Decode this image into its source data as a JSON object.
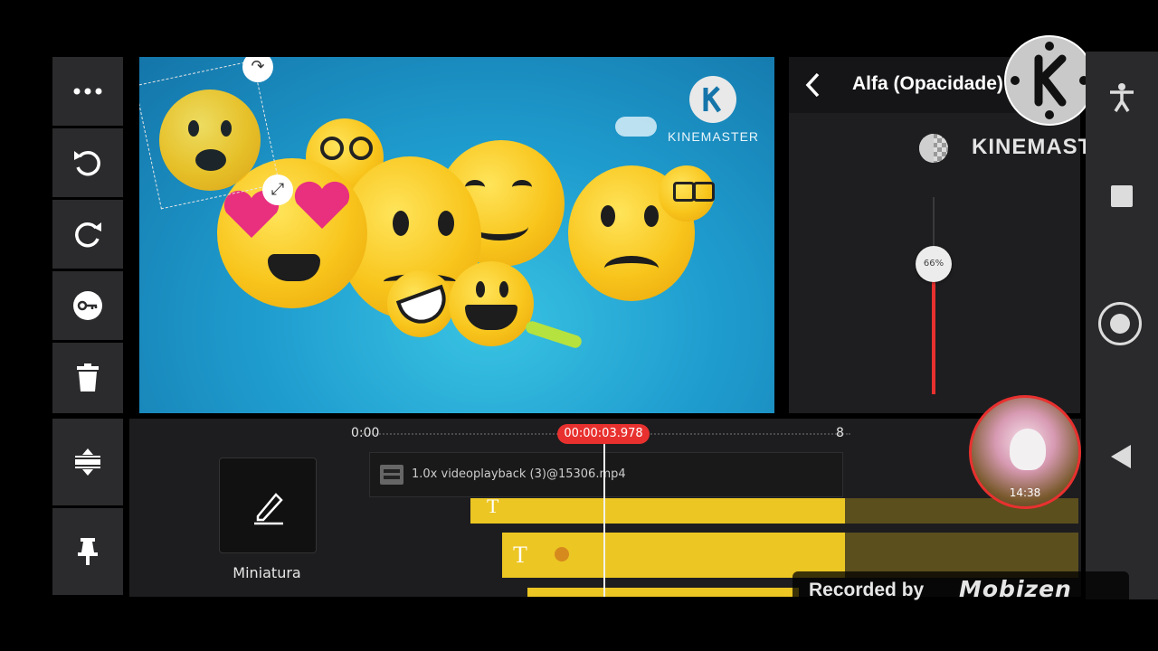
{
  "toolbar": {
    "items": [
      {
        "name": "more-icon"
      },
      {
        "name": "undo-icon"
      },
      {
        "name": "redo-icon"
      },
      {
        "name": "keyframe-key-icon"
      },
      {
        "name": "trash-icon"
      },
      {
        "name": "adjust-tracks-icon"
      },
      {
        "name": "pin-icon"
      }
    ]
  },
  "preview": {
    "watermark_text": "KINEMASTER"
  },
  "panel": {
    "title": "Alfa (Opacidade)",
    "brand_text": "KINEMASTER",
    "slider_label": "66%",
    "slider_value_percent": 66
  },
  "timeline": {
    "start_time": "0:00",
    "playhead_time": "00:00:03.978",
    "end_time": "8",
    "clip_label": "1.0x videoplayback (3)@15306.mp4",
    "thumbnail_label": "Miniatura",
    "text_layer_glyph": "T"
  },
  "overlay": {
    "recorded_by": "Recorded by",
    "recorder_brand": "Mobizen",
    "bubble_time": "14:38"
  },
  "colors": {
    "accent_red": "#e8312f",
    "track_yellow": "#ecc623",
    "panel_bg": "#1e1e20"
  }
}
